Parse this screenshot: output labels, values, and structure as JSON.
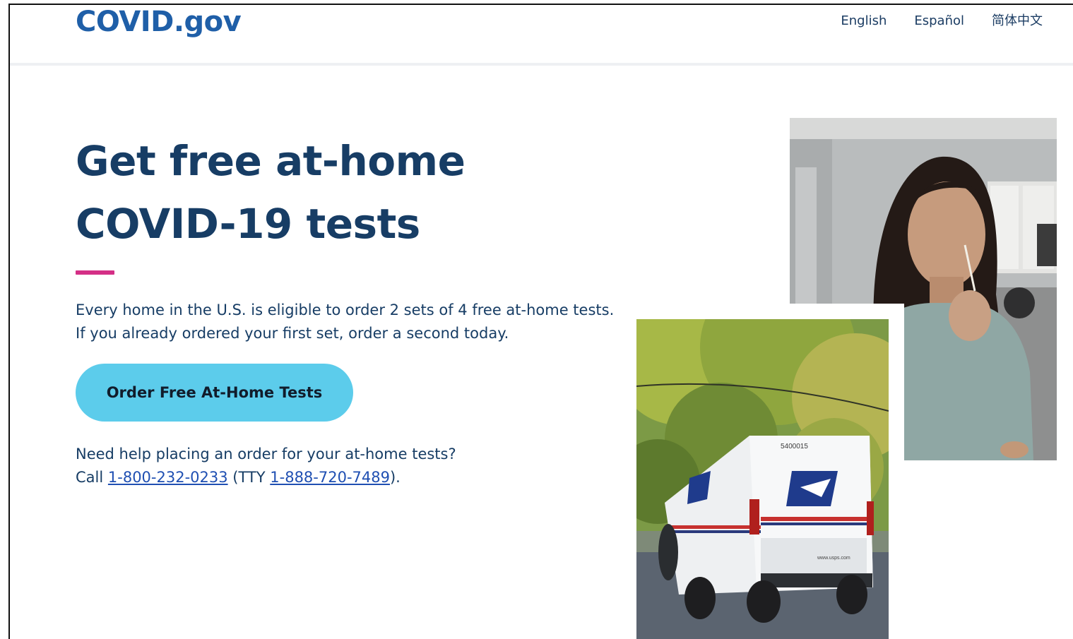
{
  "header": {
    "logo": "COVID.gov",
    "languages": [
      "English",
      "Español",
      "简体中文"
    ]
  },
  "hero": {
    "headline_line1": "Get free at-home",
    "headline_line2": "COVID-19 tests",
    "intro": "Every home in the U.S. is eligible to order 2 sets of 4 free at-home tests. If you already ordered your first set, order a second today.",
    "cta_label": "Order Free At-Home Tests",
    "help_question": "Need help placing an order for your at-home tests?",
    "help_call_prefix": "Call ",
    "help_phone": "1-800-232-0233",
    "help_tty_prefix": " (TTY ",
    "help_tty": "1-888-720-7489",
    "help_suffix": ")."
  },
  "images": {
    "van_text_number": "5400015",
    "van_text_url": "www.usps.com"
  },
  "colors": {
    "brand_blue": "#1f5fa8",
    "heading_navy": "#173d65",
    "accent_pink": "#d42f86",
    "cta_cyan": "#5ccceb",
    "link_blue": "#1f4fb2"
  }
}
